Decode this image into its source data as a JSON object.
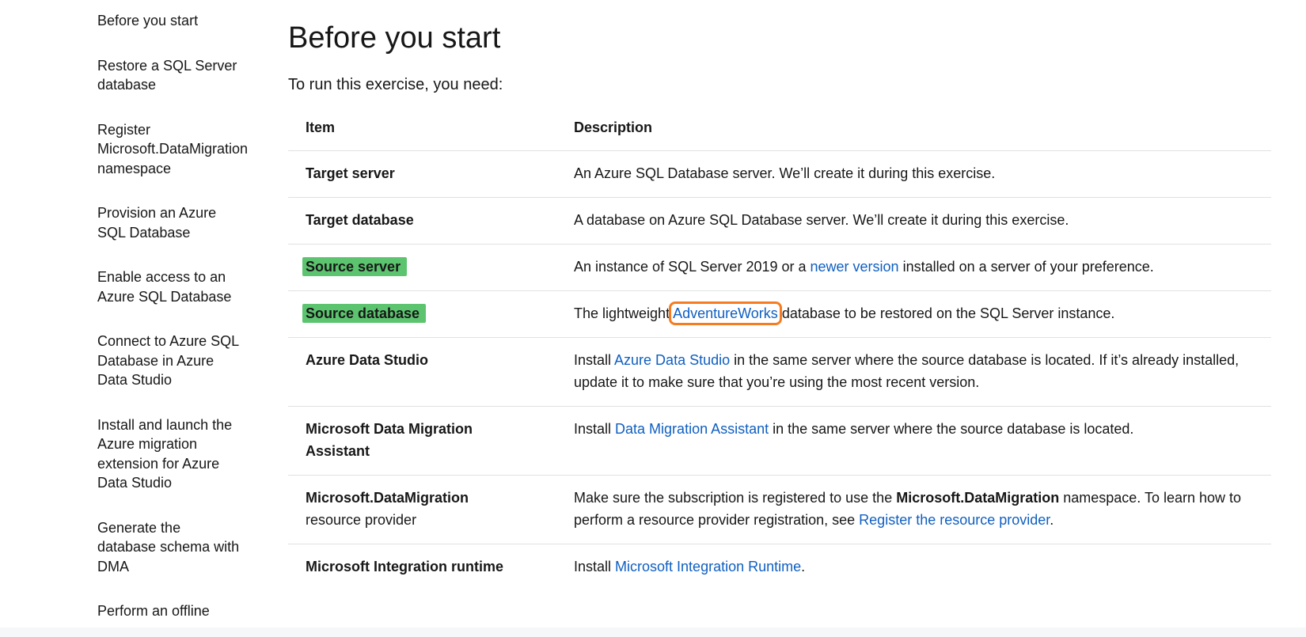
{
  "toc": {
    "items": [
      "Before you start",
      "Restore a SQL Server database",
      "Register Microsoft.DataMigration namespace",
      "Provision an Azure SQL Database",
      "Enable access to an Azure SQL Database",
      "Connect to Azure SQL Database in Azure Data Studio",
      "Install and launch the Azure migration extension for Azure Data Studio",
      "Generate the database schema with DMA",
      "Perform an offline"
    ]
  },
  "main": {
    "title": "Before you start",
    "intro": "To run this exercise, you need:",
    "table": {
      "headers": {
        "item": "Item",
        "description": "Description"
      },
      "rows": [
        {
          "item": "Target server",
          "desc": "An Azure SQL Database server. We’ll create it during this exercise."
        },
        {
          "item": "Target database",
          "desc": "A database on Azure SQL Database server. We’ll create it during this exercise."
        },
        {
          "item": "Source server",
          "desc_pre": "An instance of SQL Server 2019 or a ",
          "link": "newer version",
          "desc_post": " installed on a server of your preference."
        },
        {
          "item": "Source database",
          "desc_pre": "The lightweight ",
          "link": "AdventureWorks",
          "desc_post": " database to be restored on the SQL Server instance."
        },
        {
          "item": "Azure Data Studio",
          "desc_pre": "Install ",
          "link": "Azure Data Studio",
          "desc_post": " in the same server where the source database is located. If it’s already installed, update it to make sure that you’re using the most recent version."
        },
        {
          "item": "Microsoft Data Migration Assistant",
          "desc_pre": "Install ",
          "link": "Data Migration Assistant",
          "desc_post": " in the same server where the source database is located."
        },
        {
          "item_strong": "Microsoft.DataMigration",
          "item_rest": "resource provider",
          "desc_pre": "Make sure the subscription is registered to use the ",
          "desc_strong": "Microsoft.DataMigration",
          "desc_mid": " namespace. To learn how to perform a resource provider registration, see ",
          "link": "Register the resource provider",
          "desc_post": "."
        },
        {
          "item": "Microsoft Integration runtime",
          "desc_pre": "Install ",
          "link": "Microsoft Integration Runtime",
          "desc_post": "."
        }
      ]
    }
  },
  "colors": {
    "link": "#0f5fc1",
    "highlight": "#5cc46f",
    "annotation": "#f57c20"
  }
}
